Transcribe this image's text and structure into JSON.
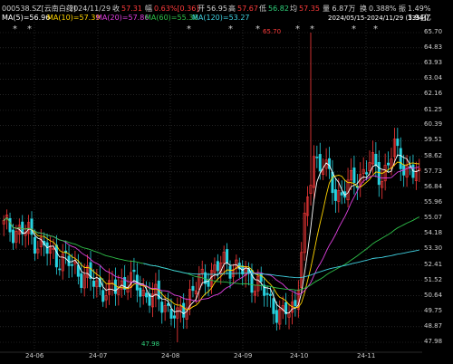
{
  "header": {
    "code": "000538.SZ[云南白药]",
    "date": "2024/11/29",
    "close_label": "收",
    "close": "57.31",
    "change_label": "幅",
    "change": "0.63%[0.36]",
    "open_label": "开",
    "open": "56.95",
    "high_label": "高",
    "high": "57.67",
    "low_label": "低",
    "low": "56.82",
    "avg_label": "均",
    "avg": "57.35",
    "volume": "量 6.87万",
    "turnover_label": "换",
    "turnover": "0.388%",
    "amp_label": "振",
    "amplitude": "1.49%",
    "amount_label": "额",
    "amount": "3.94亿",
    "range": "2024/05/15-2024/11/29 (135日)"
  },
  "ma_legend": {
    "ma5": "MA(5)=56.96",
    "ma10": "MA(10)=57.39",
    "ma20": "MA(20)=57.86",
    "ma60": "MA(60)=55.38",
    "ma120": "MA(120)=53.27",
    "colors": {
      "ma5": "#ffffff",
      "ma10": "#ffd400",
      "ma20": "#e040e0",
      "ma60": "#2fc04a",
      "ma120": "#40d0e0"
    }
  },
  "annotations": {
    "high": "65.70",
    "low": "47.98"
  },
  "stars": [
    "*",
    "*",
    "*",
    "*",
    "*",
    "*",
    "*",
    "*",
    "*"
  ],
  "chart_data": {
    "type": "candlestick",
    "y_ticks": [
      "65.70",
      "64.83",
      "63.93",
      "63.04",
      "62.16",
      "61.25",
      "60.39",
      "59.51",
      "58.62",
      "57.73",
      "56.84",
      "55.96",
      "55.07",
      "54.18",
      "53.30",
      "52.41",
      "51.52",
      "50.64",
      "49.75",
      "48.87",
      "47.98"
    ],
    "x_ticks": [
      "24-06",
      "24-07",
      "24-08",
      "24-09",
      "24-10",
      "24-11"
    ],
    "ylim": [
      47.98,
      65.7
    ],
    "colors": {
      "up": "#ff3b3b",
      "down": "#27d3e0"
    }
  }
}
